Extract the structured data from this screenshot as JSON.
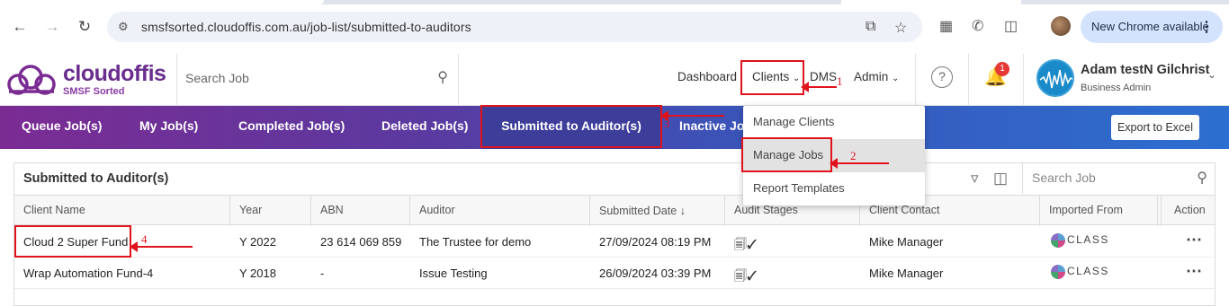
{
  "browser": {
    "url": "smsfsorted.cloudoffis.com.au/job-list/submitted-to-auditors",
    "new_chrome_label": "New Chrome available"
  },
  "header": {
    "logo_text": "cloudoffis",
    "logo_sub": "SMSF Sorted",
    "search_placeholder": "Search Job",
    "nav": {
      "dashboard": "Dashboard",
      "clients": "Clients",
      "dms": "DMS",
      "admin": "Admin"
    },
    "notification_count": "1",
    "user_name": "Adam testN Gilchrist",
    "user_role": "Business Admin"
  },
  "tabs": [
    {
      "label": "Queue Job(s)"
    },
    {
      "label": "My Job(s)"
    },
    {
      "label": "Completed Job(s)"
    },
    {
      "label": "Deleted Job(s)"
    },
    {
      "label": "Submitted to Auditor(s)"
    },
    {
      "label": "Inactive Jobs"
    }
  ],
  "export_label": "Export to Excel",
  "clients_menu": [
    {
      "label": "Manage Clients"
    },
    {
      "label": "Manage Jobs"
    },
    {
      "label": "Report Templates"
    }
  ],
  "panel": {
    "title": "Submitted to Auditor(s)",
    "search_placeholder": "Search Job",
    "columns": [
      "Client Name",
      "Year",
      "ABN",
      "Auditor",
      "Submitted Date",
      "Audit Stages",
      "Client Contact",
      "Imported From",
      "Action"
    ],
    "rows": [
      {
        "client": "Cloud 2 Super Fund",
        "year": "Y 2022",
        "abn": "23 614 069 859",
        "auditor": "The Trustee for demo",
        "submitted": "27/09/2024 08:19 PM",
        "contact": "Mike Manager",
        "imported": "CLASS"
      },
      {
        "client": "Wrap Automation Fund-4",
        "year": "Y 2018",
        "abn": "-",
        "auditor": "Issue Testing",
        "submitted": "26/09/2024 03:39 PM",
        "contact": "Mike Manager",
        "imported": "CLASS"
      }
    ]
  },
  "annotations": [
    "1",
    "2",
    "3",
    "4"
  ],
  "colors": {
    "brand_purple": "#6b2d8e",
    "tab_gradient_start": "#7b2c93",
    "tab_gradient_end": "#2c6fd0",
    "annotation_red": "#e0131d"
  }
}
